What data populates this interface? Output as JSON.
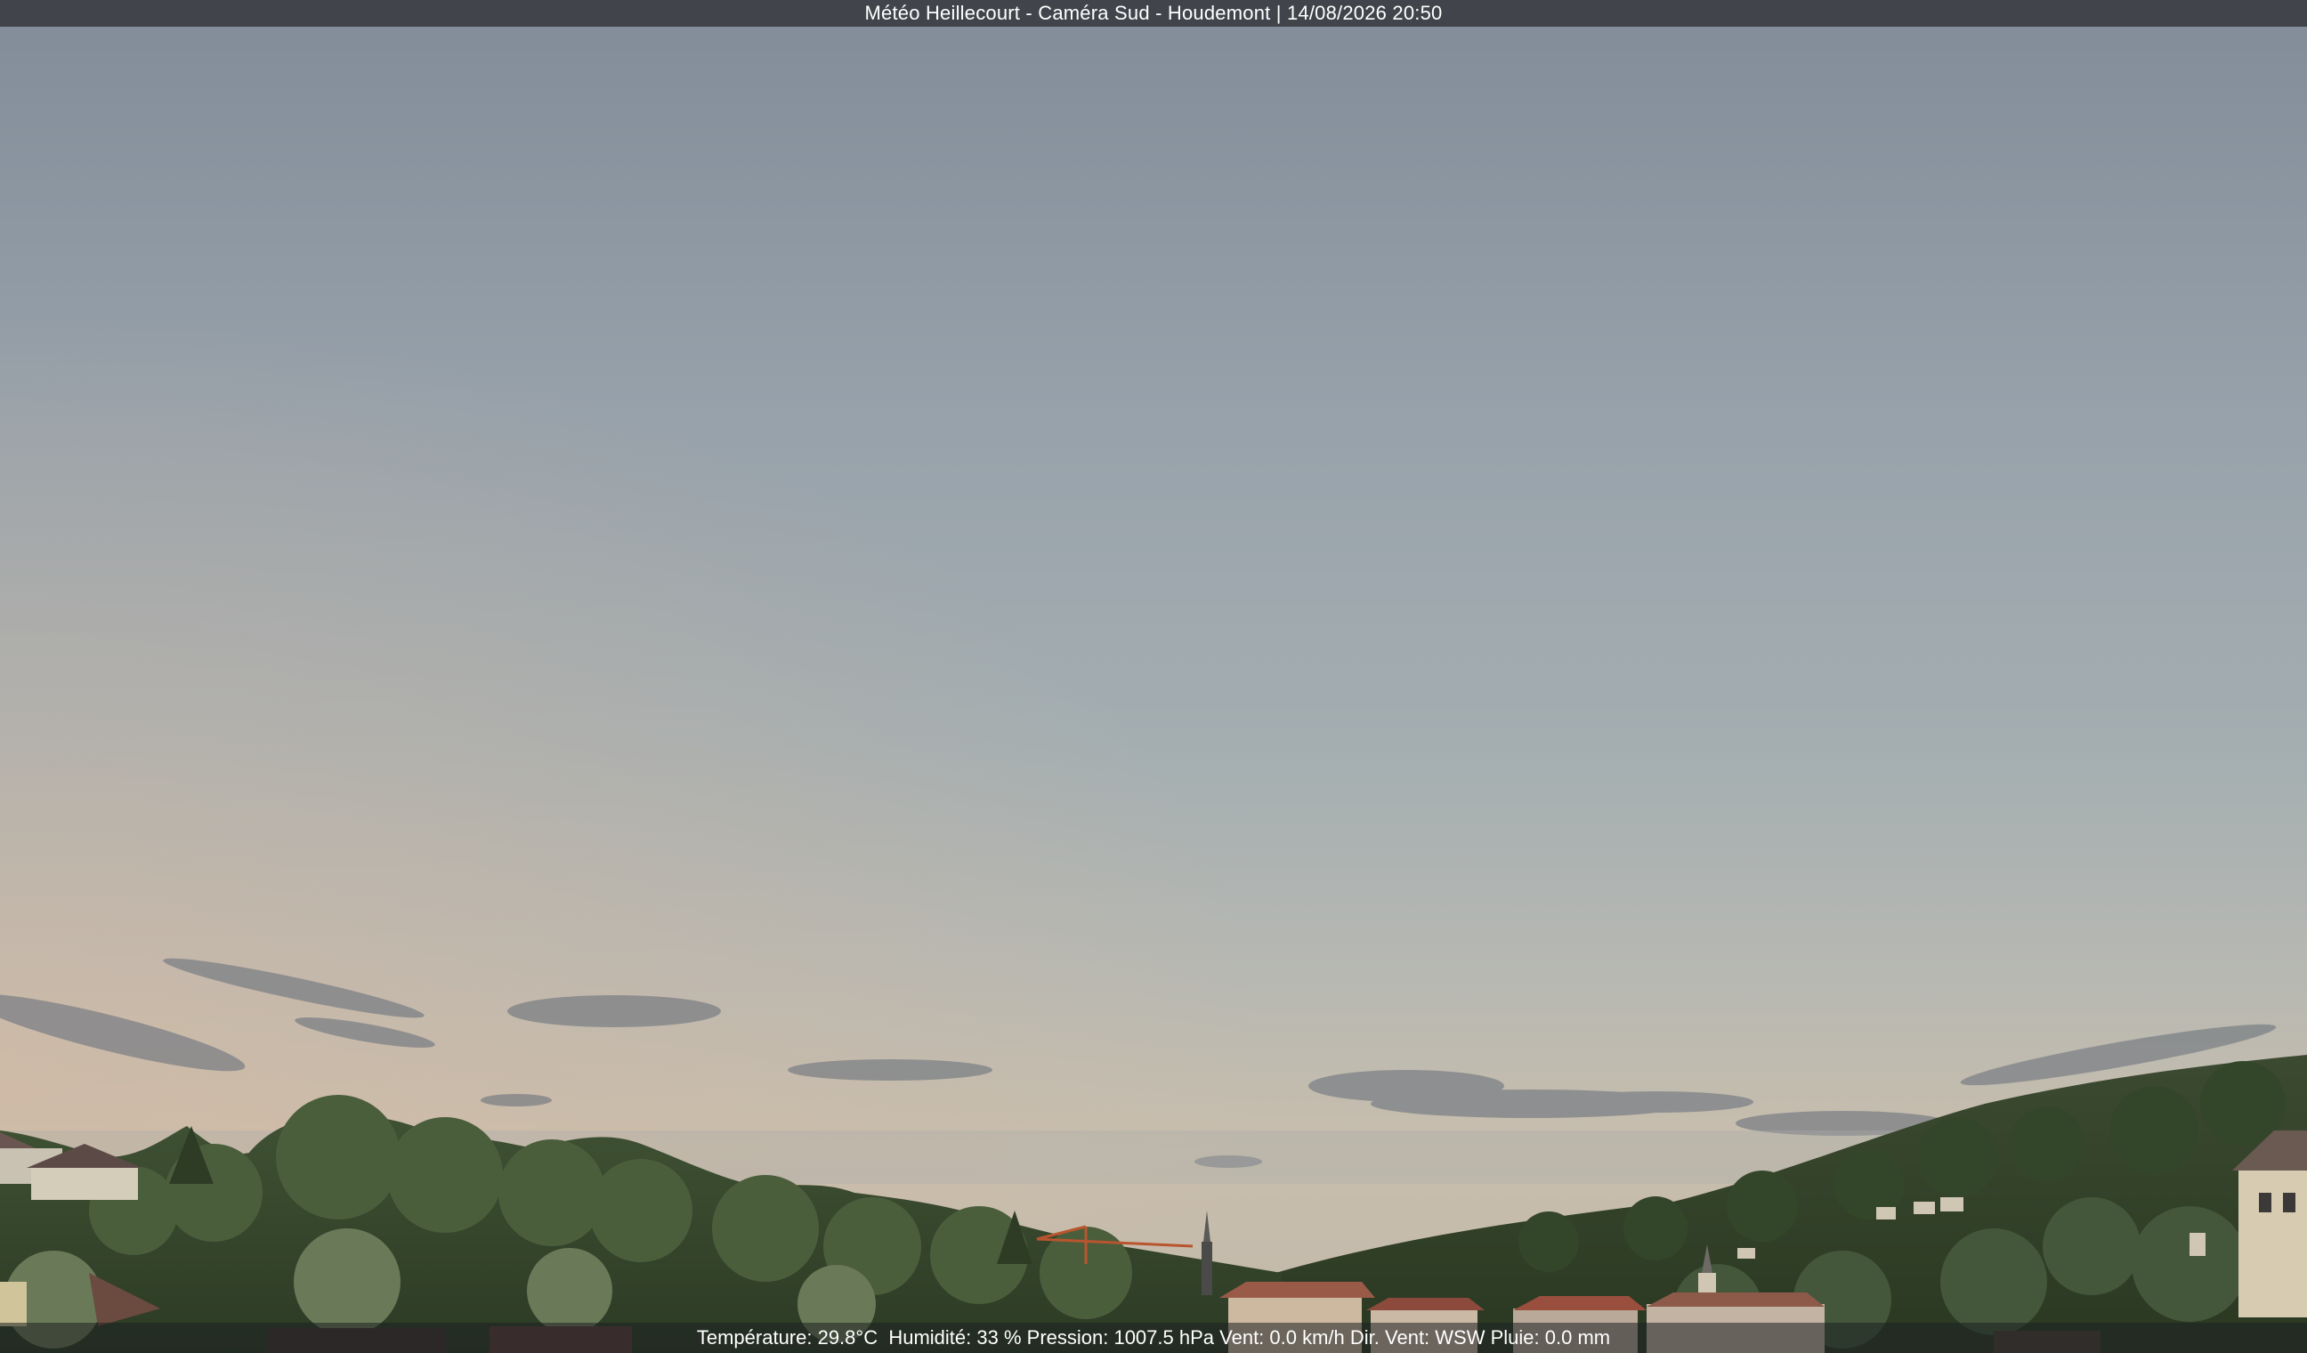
{
  "overlay": {
    "title": "Météo Heillecourt - Caméra Sud - Houdemont | 14/08/2026 20:50"
  },
  "weather": {
    "temperature": "Température: 29.8°C",
    "humidity": "Humidité: 33 %",
    "pressure": "Pression: 1007.5 hPa",
    "wind_speed": "Vent: 0.0 km/h",
    "wind_direction": "Dir. Vent: WSW",
    "rain": "Pluie: 0.0 mm"
  },
  "colors": {
    "sky_top": "#838d9a",
    "sky_mid": "#9da9b0",
    "sky_horizon": "#cbbfae",
    "treeline": "#33452a",
    "roof": "#8c4a3c",
    "overlay_bar": "#3e4248"
  }
}
